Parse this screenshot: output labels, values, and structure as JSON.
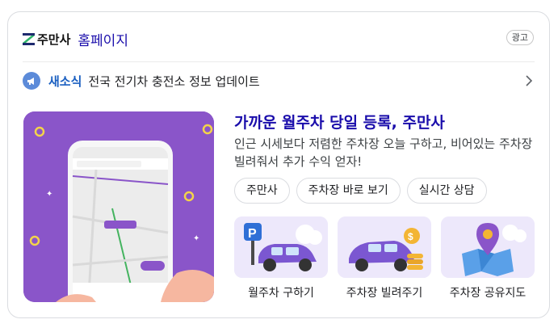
{
  "header": {
    "brand": "주만사",
    "link": "홈페이지",
    "ad_badge": "광고"
  },
  "news": {
    "label": "새소식",
    "text": "전국 전기차 충전소 정보 업데이트"
  },
  "promo": {
    "headline": "가까운 월주차 당일 등록, 주만사",
    "description": "인근 시세보다 저렴한 주차장 오늘 구하고, 비어있는 주차장 빌려줘서 추가 수익 얻자!",
    "chips": [
      "주만사",
      "주차장 바로 보기",
      "실시간 상담"
    ],
    "tiles": [
      {
        "label": "월주차 구하기",
        "icon": "parking-car-icon"
      },
      {
        "label": "주차장 빌려주기",
        "icon": "car-coins-icon"
      },
      {
        "label": "주차장 공유지도",
        "icon": "map-pin-icon"
      }
    ]
  },
  "colors": {
    "link": "#1a0dab",
    "news_label": "#1a5fc1",
    "promo_bg": "#8a55c9",
    "tile_bg": "#ede8fb"
  }
}
